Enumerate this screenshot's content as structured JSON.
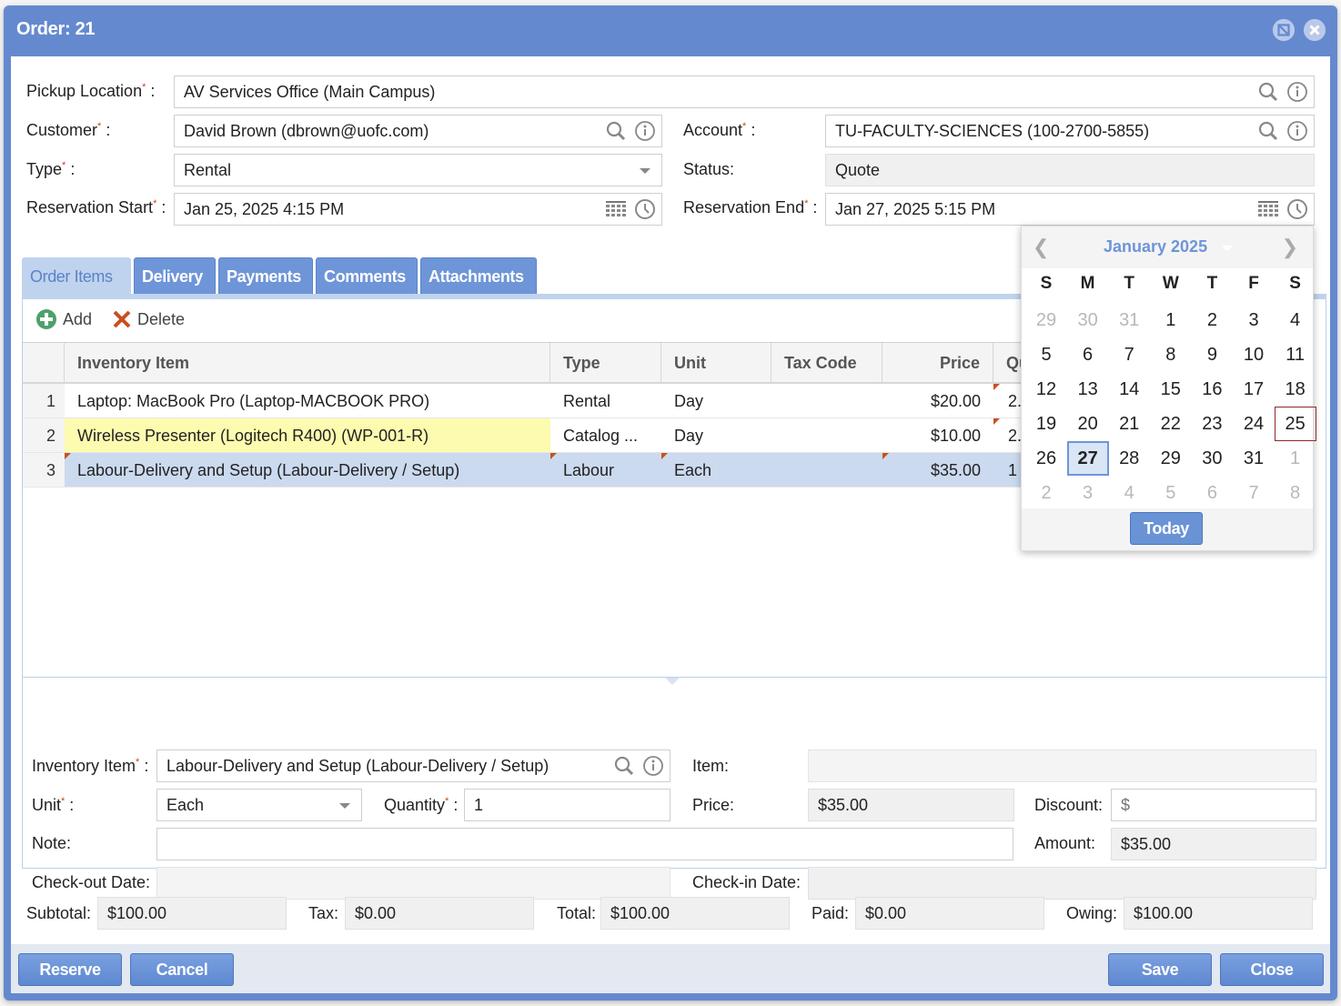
{
  "window": {
    "title": "Order: 21",
    "tools": [
      {
        "name": "minimize-icon",
        "glyph": "⊘"
      },
      {
        "name": "close-icon",
        "glyph": "✕"
      }
    ]
  },
  "header_form": {
    "pickup_location": {
      "label": "Pickup Location",
      "value": "AV Services Office (Main Campus)"
    },
    "customer": {
      "label": "Customer",
      "value": "David Brown (dbrown@uofc.com)"
    },
    "account": {
      "label": "Account",
      "value": "TU-FACULTY-SCIENCES (100-2700-5855)"
    },
    "type": {
      "label": "Type",
      "value": "Rental"
    },
    "status": {
      "label": "Status:",
      "value": "Quote"
    },
    "reservation_start": {
      "label": "Reservation Start",
      "value": "Jan 25, 2025 4:15 PM"
    },
    "reservation_end": {
      "label": "Reservation End",
      "value": "Jan 27, 2025 5:15 PM"
    },
    "required_mark": "*",
    "colon": " :"
  },
  "tabs": [
    {
      "label": "Order Items",
      "active": true
    },
    {
      "label": "Delivery"
    },
    {
      "label": "Payments"
    },
    {
      "label": "Comments"
    },
    {
      "label": "Attachments"
    }
  ],
  "toolbar": {
    "add_label": "Add",
    "delete_label": "Delete"
  },
  "grid": {
    "columns": [
      "",
      "Inventory Item",
      "Type",
      "Unit",
      "Tax Code",
      "Price",
      "Qu"
    ],
    "rows": [
      {
        "n": "1",
        "item": "Laptop: MacBook Pro (Laptop-MACBOOK PRO)",
        "type": "Rental",
        "unit": "Day",
        "tax": "",
        "price": "$20.00",
        "qty": "2.",
        "state": "normal"
      },
      {
        "n": "2",
        "item": "Wireless Presenter (Logitech R400) (WP-001-R)",
        "type": "Catalog ...",
        "unit": "Day",
        "tax": "",
        "price": "$10.00",
        "qty": "2.",
        "state": "highlight"
      },
      {
        "n": "3",
        "item": "Labour-Delivery and Setup (Labour-Delivery / Setup)",
        "type": "Labour",
        "unit": "Each",
        "tax": "",
        "price": "$35.00",
        "qty": "1",
        "state": "selected"
      }
    ]
  },
  "detail_form": {
    "inventory_item": {
      "label": "Inventory Item",
      "value": "Labour-Delivery and Setup (Labour-Delivery / Setup)"
    },
    "item": {
      "label": "Item:",
      "value": ""
    },
    "unit": {
      "label": "Unit",
      "value": "Each"
    },
    "quantity": {
      "label": "Quantity",
      "value": "1"
    },
    "price": {
      "label": "Price:",
      "value": "$35.00"
    },
    "discount": {
      "label": "Discount:",
      "placeholder": "$",
      "value": ""
    },
    "note": {
      "label": "Note:",
      "value": ""
    },
    "amount": {
      "label": "Amount:",
      "value": "$35.00"
    },
    "checkout_date": {
      "label": "Check-out Date:",
      "value": ""
    },
    "checkin_date": {
      "label": "Check-in Date:",
      "value": ""
    }
  },
  "totals": {
    "subtotal": {
      "label": "Subtotal:",
      "value": "$100.00"
    },
    "tax": {
      "label": "Tax:",
      "value": "$0.00"
    },
    "total": {
      "label": "Total:",
      "value": "$100.00"
    },
    "paid": {
      "label": "Paid:",
      "value": "$0.00"
    },
    "owing": {
      "label": "Owing:",
      "value": "$100.00"
    }
  },
  "footer": {
    "reserve_label": "Reserve",
    "cancel_label": "Cancel",
    "save_label": "Save",
    "close_label": "Close"
  },
  "calendar": {
    "title": "January 2025",
    "prev": "❮",
    "next": "❯",
    "weekdays": [
      "S",
      "M",
      "T",
      "W",
      "T",
      "F",
      "S"
    ],
    "weeks": [
      [
        {
          "d": "29",
          "o": true
        },
        {
          "d": "30",
          "o": true
        },
        {
          "d": "31",
          "o": true
        },
        {
          "d": "1"
        },
        {
          "d": "2"
        },
        {
          "d": "3"
        },
        {
          "d": "4"
        }
      ],
      [
        {
          "d": "5"
        },
        {
          "d": "6"
        },
        {
          "d": "7"
        },
        {
          "d": "8"
        },
        {
          "d": "9"
        },
        {
          "d": "10"
        },
        {
          "d": "11"
        }
      ],
      [
        {
          "d": "12"
        },
        {
          "d": "13"
        },
        {
          "d": "14"
        },
        {
          "d": "15"
        },
        {
          "d": "16"
        },
        {
          "d": "17"
        },
        {
          "d": "18"
        }
      ],
      [
        {
          "d": "19"
        },
        {
          "d": "20"
        },
        {
          "d": "21"
        },
        {
          "d": "22"
        },
        {
          "d": "23"
        },
        {
          "d": "24"
        },
        {
          "d": "25",
          "today": true
        }
      ],
      [
        {
          "d": "26"
        },
        {
          "d": "27",
          "selected": true
        },
        {
          "d": "28"
        },
        {
          "d": "29"
        },
        {
          "d": "30"
        },
        {
          "d": "31"
        },
        {
          "d": "1",
          "o": true
        }
      ],
      [
        {
          "d": "2",
          "o": true
        },
        {
          "d": "3",
          "o": true
        },
        {
          "d": "4",
          "o": true
        },
        {
          "d": "5",
          "o": true
        },
        {
          "d": "6",
          "o": true
        },
        {
          "d": "7",
          "o": true
        },
        {
          "d": "8",
          "o": true
        }
      ]
    ],
    "today_label": "Today"
  },
  "colors": {
    "accent": "#6589cf",
    "tab_active_bg": "#bfd3ee",
    "row_selected": "#cbdaef",
    "row_highlight": "#fdfbb0",
    "required": "#d04020"
  }
}
